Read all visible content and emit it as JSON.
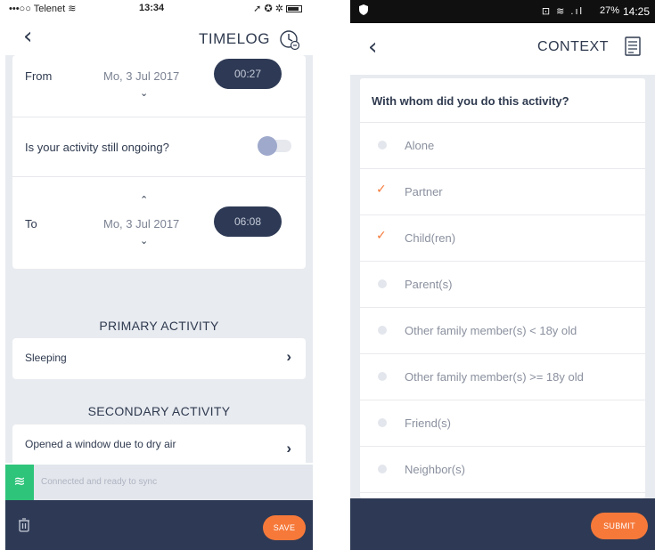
{
  "left": {
    "status": {
      "carrier": "•••○○ Telenet ≋",
      "time": "13:34",
      "right_icons": "➚ ✪ ✲"
    },
    "header": {
      "title": "TIMELOG"
    },
    "from": {
      "label": "From",
      "date": "Mo, 3 Jul 2017",
      "time": "00:27"
    },
    "ongoing": {
      "question": "Is your activity still ongoing?",
      "toggle_on": false
    },
    "to": {
      "label": "To",
      "date": "Mo, 3 Jul 2017",
      "time": "06:08"
    },
    "primary": {
      "title": "PRIMARY ACTIVITY",
      "value": "Sleeping"
    },
    "secondary": {
      "title": "SECONDARY ACTIVITY",
      "value": "Opened a window due to dry air"
    },
    "sync": {
      "text": "Connected and ready to sync"
    },
    "footer": {
      "save_label": "SAVE"
    }
  },
  "right": {
    "status": {
      "icons": "⊡ ≋ .ıl",
      "battery": "27%",
      "time": "14:25"
    },
    "header": {
      "title": "CONTEXT"
    },
    "question": "With whom did you do this activity?",
    "options": [
      {
        "label": "Alone",
        "checked": false
      },
      {
        "label": "Partner",
        "checked": true
      },
      {
        "label": "Child(ren)",
        "checked": true
      },
      {
        "label": "Parent(s)",
        "checked": false
      },
      {
        "label": "Other family member(s) < 18y old",
        "checked": false
      },
      {
        "label": "Other family member(s) >= 18y old",
        "checked": false
      },
      {
        "label": "Friend(s)",
        "checked": false
      },
      {
        "label": "Neighbor(s)",
        "checked": false
      }
    ],
    "footer": {
      "submit_label": "SUBMIT"
    }
  },
  "colors": {
    "navy": "#2e3a55",
    "orange": "#f6793a",
    "green": "#2ec47a",
    "background": "#e8ebf0"
  }
}
